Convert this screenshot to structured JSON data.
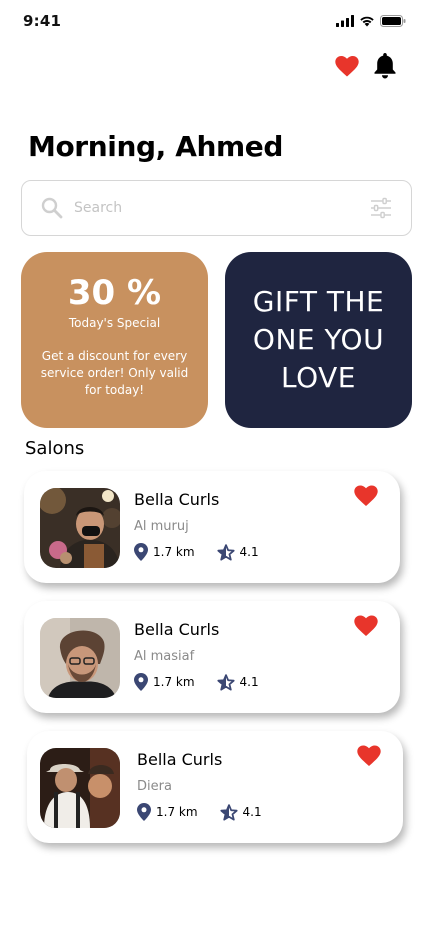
{
  "status": {
    "time": "9:41"
  },
  "header": {
    "greeting": "Morning, Ahmed"
  },
  "search": {
    "placeholder": "Search"
  },
  "promos": {
    "discount": {
      "percent": "30 %",
      "subtitle": "Today's Special",
      "description": "Get a discount for every service order! Only valid for today!"
    },
    "gift": {
      "text": "GIFT THE ONE YOU LOVE"
    }
  },
  "salons": {
    "title": "Salons",
    "items": [
      {
        "name": "Bella Curls",
        "area": "Al muruj",
        "distance": "1.7 km",
        "rating": "4.1"
      },
      {
        "name": "Bella Curls",
        "area": "Al masiaf",
        "distance": "1.7 km",
        "rating": "4.1"
      },
      {
        "name": "Bella Curls",
        "area": "Diera",
        "distance": "1.7 km",
        "rating": "4.1"
      }
    ]
  },
  "colors": {
    "accent_red": "#e8352b",
    "promo_orange": "#c8915f",
    "promo_navy": "#1f2540",
    "meta_icon": "#3b4773"
  },
  "icons": [
    "cellular-icon",
    "wifi-icon",
    "battery-icon",
    "heart-icon",
    "bell-icon",
    "search-icon",
    "filter-icon",
    "location-pin-icon",
    "star-icon"
  ]
}
